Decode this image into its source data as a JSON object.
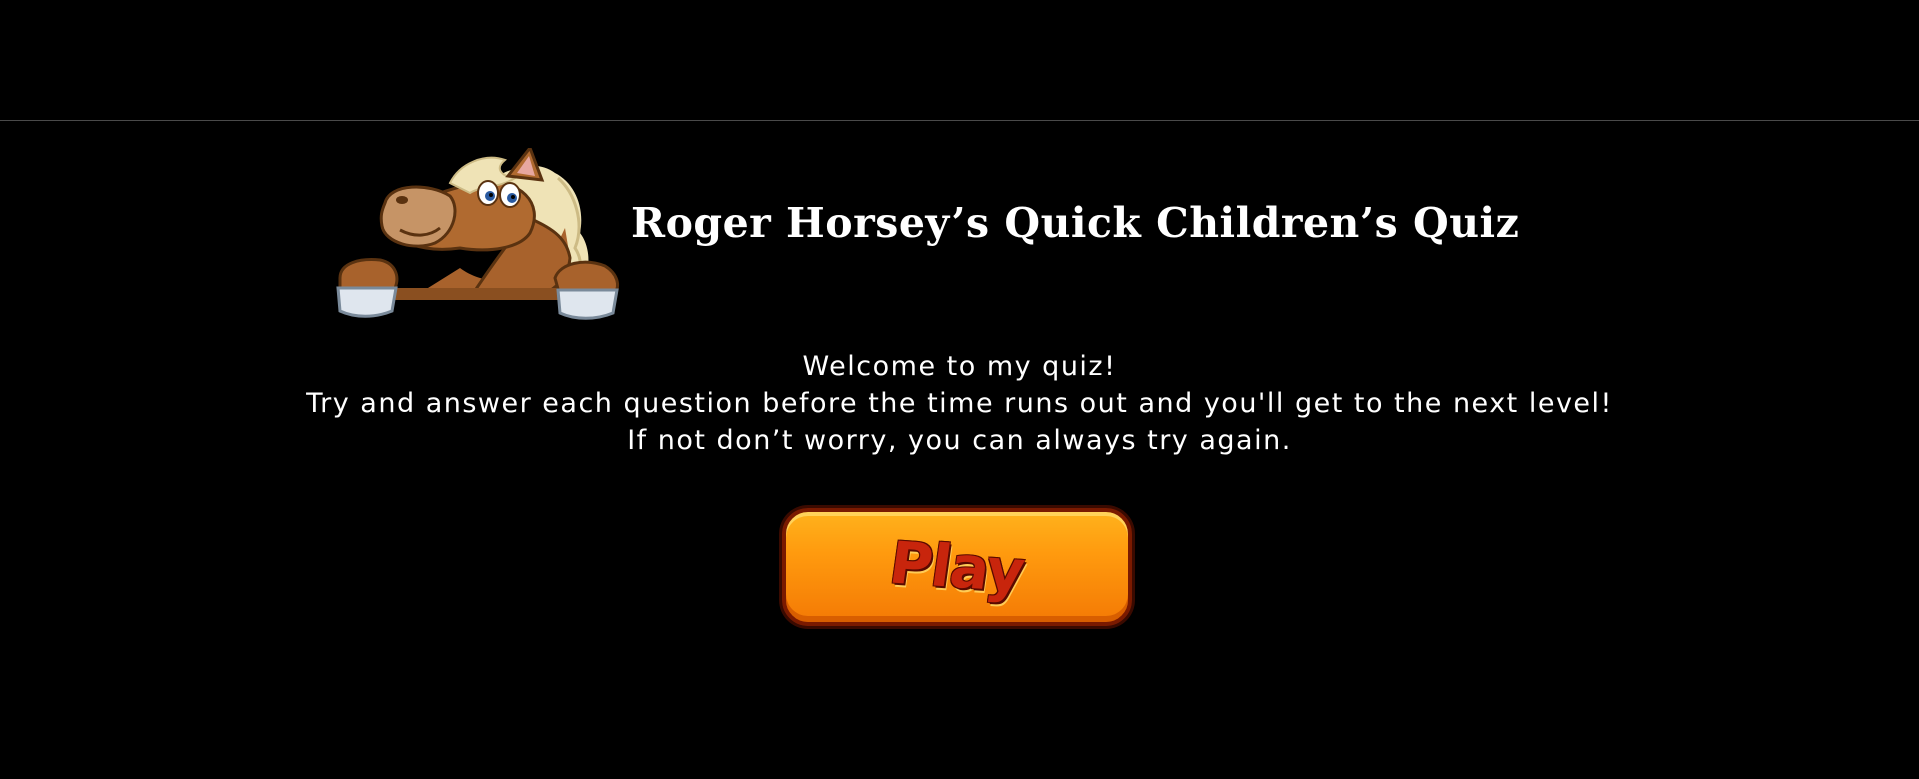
{
  "quiz": {
    "title": "Roger Horsey’s Quick Children’s Quiz",
    "intro_lines": [
      "Welcome to my quiz!",
      "Try and answer each question before the time runs out and you'll get to the next level!",
      "If not don’t worry, you can always try again."
    ],
    "play_label": "Play",
    "mascot_icon": "horse-mascot-icon"
  },
  "colors": {
    "background": "#000000",
    "text": "#ffffff",
    "button_orange": "#f47a05",
    "button_text": "#c8250c"
  }
}
